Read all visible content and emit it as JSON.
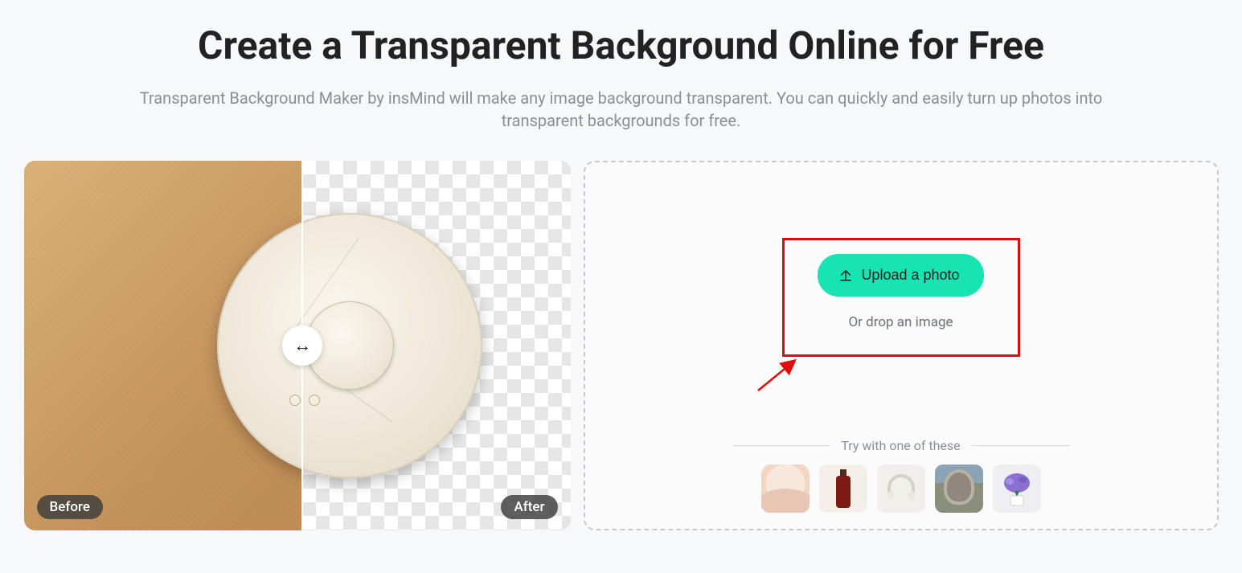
{
  "header": {
    "title": "Create a Transparent Background Online for Free",
    "description": "Transparent Background Maker by insMind will make any image background transparent. You can quickly and easily turn up photos into transparent backgrounds for free."
  },
  "slider": {
    "before_label": "Before",
    "after_label": "After",
    "handle_icon": "↔",
    "divider_position_pct": 51
  },
  "upload": {
    "button_label": "Upload a photo",
    "drop_hint": "Or drop an image",
    "samples_label": "Try with one of these",
    "samples": [
      {
        "name": "sample-woman",
        "alt": "woman portrait"
      },
      {
        "name": "sample-bottle",
        "alt": "product bottle"
      },
      {
        "name": "sample-headphones",
        "alt": "headphones"
      },
      {
        "name": "sample-outdoor",
        "alt": "person outdoors"
      },
      {
        "name": "sample-flowers",
        "alt": "flowers in pot"
      }
    ]
  },
  "annotation": {
    "type": "highlight-rectangle-with-arrow",
    "target": "upload-button",
    "color": "#e30a0a"
  }
}
